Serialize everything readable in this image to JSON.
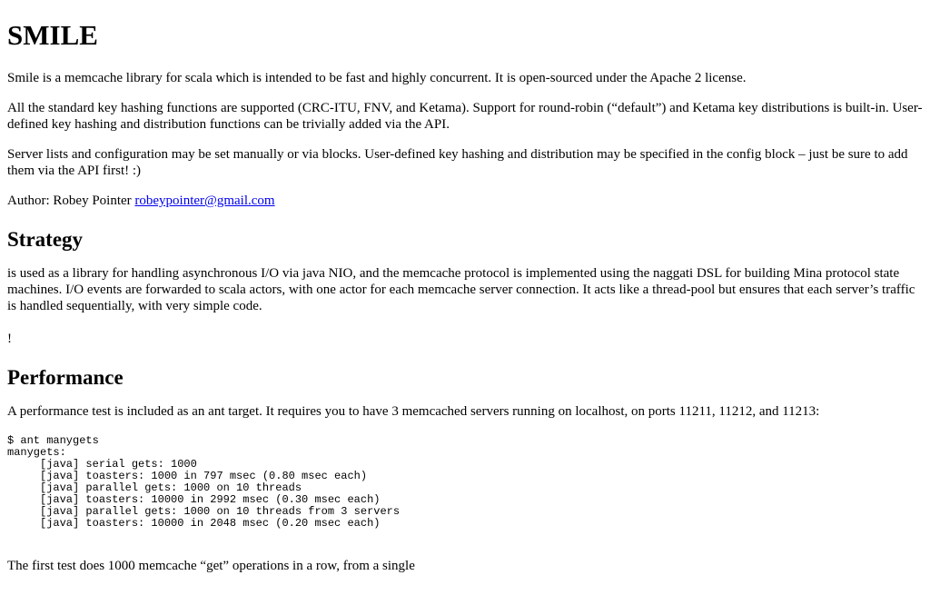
{
  "title": "SMILE",
  "intro": "Smile is a memcache library for scala which is intended to be fast and highly concurrent. It is open-sourced under the Apache 2 license.",
  "hashing": "All the standard key hashing functions are supported (CRC-ITU, FNV, and Ketama). Support for round-robin (“default”) and Ketama key distributions is built-in. User-defined key hashing and distribution functions can be trivially added via the API.",
  "config": "Server lists and configuration may be set manually or via blocks. User-defined key hashing and distribution may be specified in the config block – just be sure to add them via the API first! :)",
  "author": {
    "label": "Author: Robey Pointer ",
    "email": "robeypointer@gmail.com"
  },
  "strategy": {
    "heading": "Strategy",
    "body": "is used as a library for handling asynchronous I/O via java NIO, and the memcache protocol is implemented using the naggati DSL for building Mina protocol state machines. I/O events are forwarded to scala actors, with one actor for each memcache server connection. It acts like a thread-pool but ensures that each server’s traffic is handled sequentially, with very simple code.",
    "bang": "!"
  },
  "performance": {
    "heading": "Performance",
    "body": "A performance test is included as an ant target. It requires you to have 3 memcached servers running on localhost, on ports 11211, 11212, and 11213:",
    "code": "$ ant manygets\nmanygets:\n     [java] serial gets: 1000\n     [java] toasters: 1000 in 797 msec (0.80 msec each)\n     [java] parallel gets: 1000 on 10 threads\n     [java] toasters: 10000 in 2992 msec (0.30 msec each)\n     [java] parallel gets: 1000 on 10 threads from 3 servers\n     [java] toasters: 10000 in 2048 msec (0.20 msec each)",
    "followup": "The first test does 1000 memcache “get” operations in a row, from a single"
  }
}
